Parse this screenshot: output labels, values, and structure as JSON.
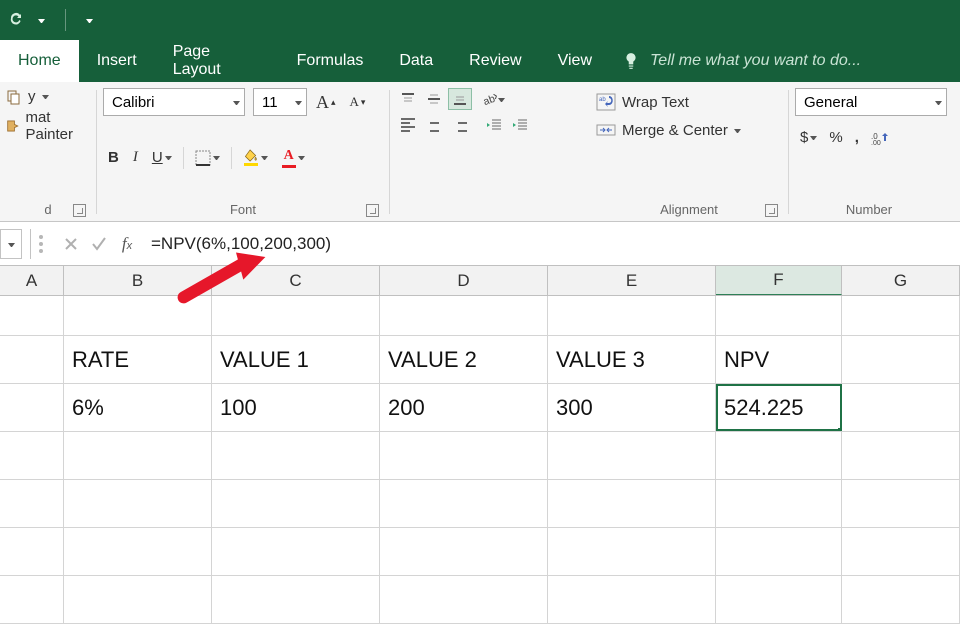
{
  "tabs": [
    "Home",
    "Insert",
    "Page Layout",
    "Formulas",
    "Data",
    "Review",
    "View"
  ],
  "active_tab": "Home",
  "tellme_placeholder": "Tell me what you want to do...",
  "clipboard": {
    "copy_label_suffix": "y",
    "format_painter": "mat Painter",
    "group_label": "d"
  },
  "font": {
    "name": "Calibri",
    "size": "11",
    "group_label": "Font"
  },
  "alignment": {
    "wrap_text": "Wrap Text",
    "merge_center": "Merge & Center",
    "group_label": "Alignment"
  },
  "number": {
    "format": "General",
    "currency": "$",
    "percent": "%",
    "comma": ",",
    "group_label": "Number"
  },
  "formula_bar": {
    "formula": "=NPV(6%,100,200,300)"
  },
  "columns": [
    "A",
    "B",
    "C",
    "D",
    "E",
    "F",
    "G"
  ],
  "selected_col": "F",
  "rows": [
    {
      "A": "",
      "B": "",
      "C": "",
      "D": "",
      "E": "",
      "F": "",
      "G": ""
    },
    {
      "A": "",
      "B": "RATE",
      "C": "VALUE 1",
      "D": "VALUE 2",
      "E": "VALUE 3",
      "F": "NPV",
      "G": ""
    },
    {
      "A": "",
      "B": "6%",
      "C": "100",
      "D": "200",
      "E": "300",
      "F": "524.225",
      "G": ""
    },
    {
      "A": "",
      "B": "",
      "C": "",
      "D": "",
      "E": "",
      "F": "",
      "G": ""
    },
    {
      "A": "",
      "B": "",
      "C": "",
      "D": "",
      "E": "",
      "F": "",
      "G": ""
    },
    {
      "A": "",
      "B": "",
      "C": "",
      "D": "",
      "E": "",
      "F": "",
      "G": ""
    },
    {
      "A": "",
      "B": "",
      "C": "",
      "D": "",
      "E": "",
      "F": "",
      "G": ""
    }
  ],
  "selected_cell": {
    "row": 2,
    "col": "F"
  }
}
